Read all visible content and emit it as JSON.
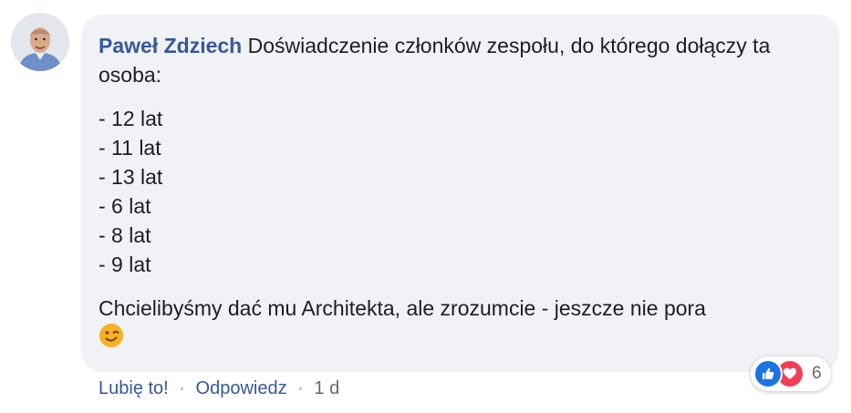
{
  "comment": {
    "author": "Paweł Zdziech",
    "intro": "Doświadczenie członków zespołu, do którego dołączy ta osoba:",
    "list": [
      "- 12 lat",
      "- 11 lat",
      "- 13 lat",
      "- 6 lat",
      "- 8 lat",
      "- 9 lat"
    ],
    "closing": "Chcielibyśmy dać mu Architekta, ale zrozumcie - jeszcze nie pora",
    "emoji": "wink-emoji"
  },
  "actions": {
    "like": "Lubię to!",
    "reply": "Odpowiedz",
    "separator": "·",
    "time": "1 d"
  },
  "reactions": {
    "icons": [
      "like-icon",
      "love-icon"
    ],
    "count": "6"
  },
  "colors": {
    "bubble": "#f0f2f5",
    "link": "#385898",
    "like": "#1b74e4",
    "love": "#f33e58",
    "emoji": "#f7b125"
  }
}
